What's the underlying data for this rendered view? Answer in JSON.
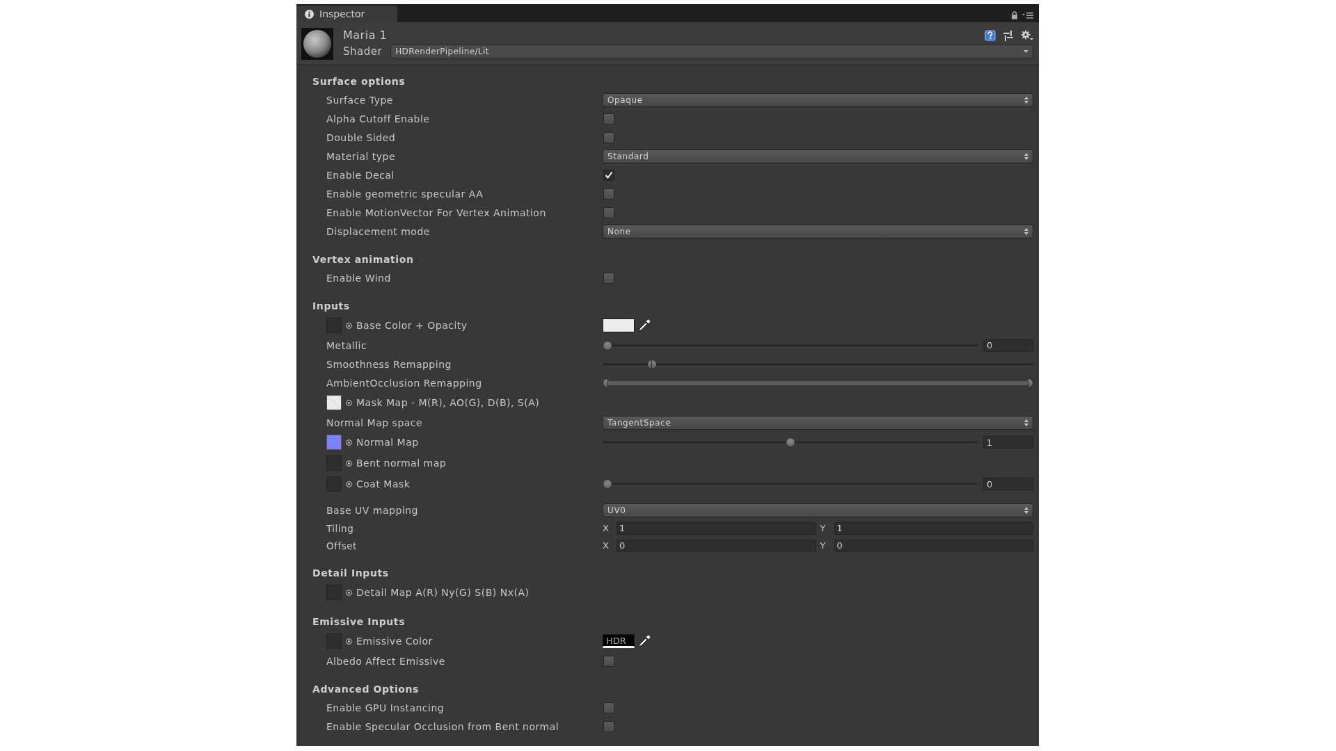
{
  "tab": {
    "label": "Inspector",
    "selected": true
  },
  "material": {
    "name": "Maria 1",
    "shader_label": "Shader",
    "shader": "HDRenderPipeline/Lit"
  },
  "sections": [
    {
      "title": "Surface options",
      "rows": [
        {
          "kind": "dropdown",
          "label": "Surface Type",
          "value": "Opaque"
        },
        {
          "kind": "checkbox",
          "label": "Alpha Cutoff Enable",
          "checked": false
        },
        {
          "kind": "checkbox",
          "label": "Double Sided",
          "checked": false
        },
        {
          "kind": "dropdown",
          "label": "Material type",
          "value": "Standard"
        },
        {
          "kind": "checkbox",
          "label": "Enable Decal",
          "checked": true
        },
        {
          "kind": "checkbox",
          "label": "Enable geometric specular AA",
          "checked": false
        },
        {
          "kind": "checkbox",
          "label": "Enable MotionVector For Vertex Animation",
          "checked": false
        },
        {
          "kind": "dropdown",
          "label": "Displacement mode",
          "value": "None"
        }
      ]
    },
    {
      "title": "Vertex animation",
      "rows": [
        {
          "kind": "checkbox",
          "label": "Enable Wind",
          "checked": false
        }
      ]
    },
    {
      "title": "Inputs",
      "groups": [
        [
          {
            "kind": "texture",
            "label": "Base Color + Opacity",
            "thumbnail": {
              "kind": "empty"
            },
            "control": {
              "kind": "color",
              "color": "#ececec"
            }
          },
          {
            "kind": "slider",
            "label": "Metallic",
            "level": 0,
            "value": "0"
          },
          {
            "kind": "range",
            "label": "Smoothness Remapping",
            "handles": [
              {
                "level": 0.105
              },
              {
                "level": 0.115
              }
            ]
          },
          {
            "kind": "range",
            "label": "AmbientOcclusion Remapping",
            "handles": [
              {
                "level": 0
              },
              {
                "level": 1
              }
            ]
          },
          {
            "kind": "texture",
            "label": "Mask Map - M(R), AO(G), D(B), S(A)",
            "thumbnail": {
              "kind": "noise"
            }
          },
          {
            "kind": "dropdown",
            "label": "Normal Map space",
            "value": "TangentSpace"
          },
          {
            "kind": "texture",
            "label": "Normal Map",
            "thumbnail": {
              "kind": "normal"
            },
            "control": {
              "kind": "slider",
              "level": 0.5,
              "value": "1"
            }
          },
          {
            "kind": "texture",
            "label": "Bent normal map",
            "thumbnail": {
              "kind": "empty"
            }
          },
          {
            "kind": "texture",
            "label": "Coat Mask",
            "thumbnail": {
              "kind": "empty"
            },
            "control": {
              "kind": "slider",
              "level": 0,
              "value": "0"
            }
          }
        ],
        [
          {
            "kind": "dropdown",
            "label": "Base UV mapping",
            "value": "UV0"
          },
          {
            "kind": "vector2",
            "label": "Tiling",
            "components": [
              {
                "axis": "X",
                "value": "1"
              },
              {
                "axis": "Y",
                "value": "1"
              }
            ]
          },
          {
            "kind": "vector2",
            "label": "Offset",
            "components": [
              {
                "axis": "X",
                "value": "0"
              },
              {
                "axis": "Y",
                "value": "0"
              }
            ]
          }
        ]
      ]
    },
    {
      "title": "Detail Inputs",
      "rows": [
        {
          "kind": "texture",
          "label": "Detail Map A(R) Ny(G) S(B) Nx(A)",
          "thumbnail": {
            "kind": "empty"
          }
        }
      ]
    },
    {
      "title": "Emissive Inputs",
      "rows": [
        {
          "kind": "texture",
          "label": "Emissive Color",
          "thumbnail": {
            "kind": "empty"
          },
          "control": {
            "kind": "hdr",
            "label": "HDR",
            "color": "#000000"
          }
        },
        {
          "kind": "checkbox",
          "label": "Albedo Affect Emissive",
          "checked": false
        }
      ]
    },
    {
      "title": "Advanced Options",
      "rows": [
        {
          "kind": "checkbox",
          "label": "Enable GPU Instancing",
          "checked": false
        },
        {
          "kind": "checkbox",
          "label": "Enable Specular Occlusion from Bent normal",
          "checked": false
        }
      ]
    }
  ]
}
